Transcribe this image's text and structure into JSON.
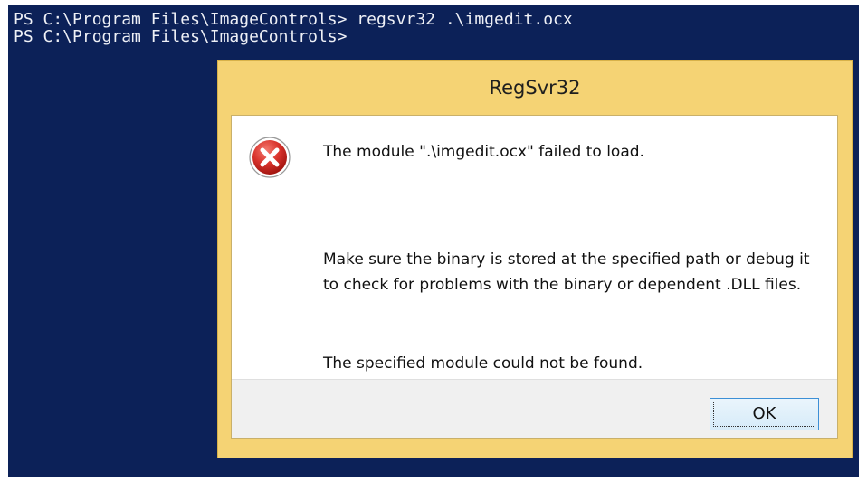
{
  "console": {
    "line1": "PS C:\\Program Files\\ImageControls> regsvr32 .\\imgedit.ocx",
    "line2": "PS C:\\Program Files\\ImageControls>"
  },
  "dialog": {
    "title": "RegSvr32",
    "icon": "error-icon",
    "message_primary": "The module \".\\imgedit.ocx\" failed to load.",
    "message_detail": "Make sure the binary is stored at the specified path or debug it to check for problems with the binary or dependent .DLL files.",
    "message_error": "The specified module could not be found.",
    "ok_label": "OK"
  },
  "colors": {
    "console_background": "#0c2158",
    "dialog_frame": "#f5d374",
    "error_red": "#d9332c"
  }
}
